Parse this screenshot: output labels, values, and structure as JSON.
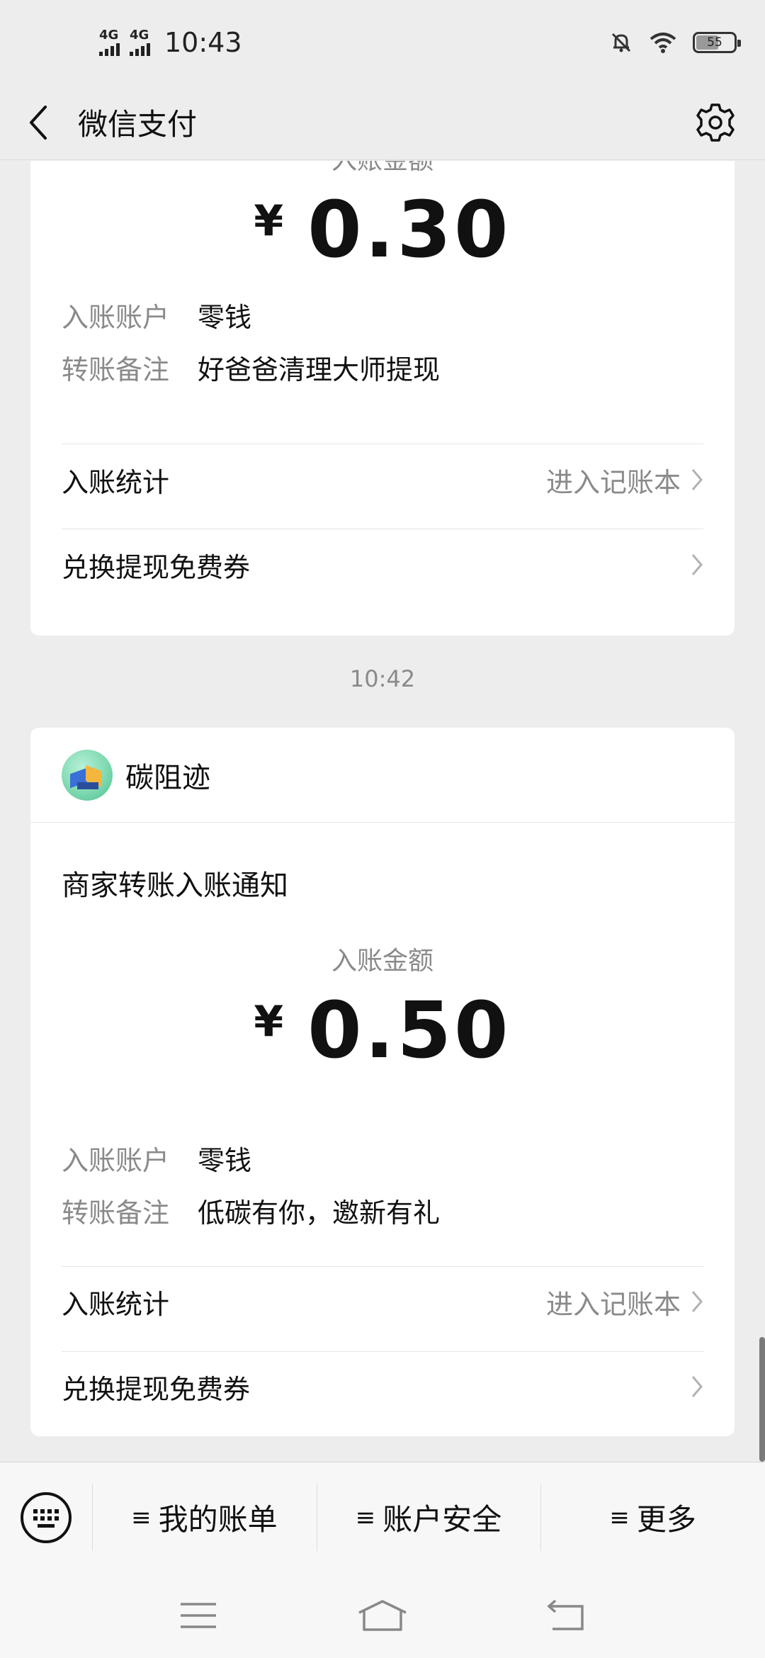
{
  "status_bar": {
    "net1": "4G",
    "net2": "4G",
    "time": "10:43",
    "battery": "55"
  },
  "header": {
    "title": "微信支付"
  },
  "card_top": {
    "amount_label": "入账金额",
    "currency": "¥",
    "amount": "0.30",
    "account_label": "入账账户",
    "account_value": "零钱",
    "remark_label": "转账备注",
    "remark_value": "好爸爸清理大师提现",
    "stats_label": "入账统计",
    "stats_hint": "进入记账本",
    "coupon_label": "兑换提现免费券"
  },
  "separator_time": "10:42",
  "card_bottom": {
    "merchant_name": "碳阻迹",
    "notice_title": "商家转账入账通知",
    "amount_label": "入账金额",
    "currency": "¥",
    "amount": "0.50",
    "account_label": "入账账户",
    "account_value": "零钱",
    "remark_label": "转账备注",
    "remark_value": "低碳有你，邀新有礼",
    "stats_label": "入账统计",
    "stats_hint": "进入记账本",
    "coupon_label": "兑换提现免费券"
  },
  "menu": {
    "bill": "我的账单",
    "security": "账户安全",
    "more": "更多"
  },
  "icons": {
    "back": "back-arrow-icon",
    "settings": "gear-icon",
    "keyboard": "keyboard-icon",
    "chevron": "chevron-right-icon"
  }
}
